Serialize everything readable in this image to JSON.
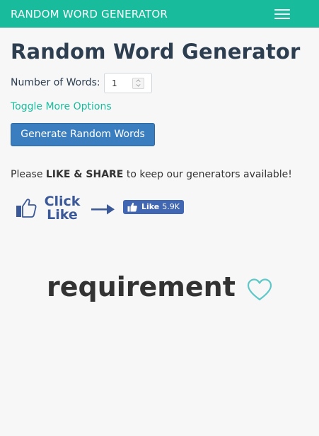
{
  "navbar": {
    "brand": "RANDOM WORD GENERATOR",
    "menu_icon": "hamburger-menu-icon",
    "bg_color": "#18bc9c"
  },
  "page": {
    "title": "Random Word Generator"
  },
  "form": {
    "num_words_label": "Number of Words:",
    "num_words_value": "1",
    "toggle_label": "Toggle More Options",
    "generate_label": "Generate Random Words"
  },
  "share": {
    "prefix": "Please ",
    "emphasis": "LIKE & SHARE",
    "suffix": " to keep our generators available!",
    "click_line1": "Click",
    "click_line2": "Like",
    "thumb_icon": "thumbs-up-icon",
    "arrow_icon": "arrow-right-icon",
    "fb_like_label": "Like",
    "fb_like_count": "5.9K"
  },
  "result": {
    "word": "requirement",
    "favorite_icon": "heart-outline-icon"
  },
  "colors": {
    "accent": "#18bc9c",
    "button": "#3a7ebf",
    "facebook": "#3b5998",
    "title": "#2c3e50"
  }
}
